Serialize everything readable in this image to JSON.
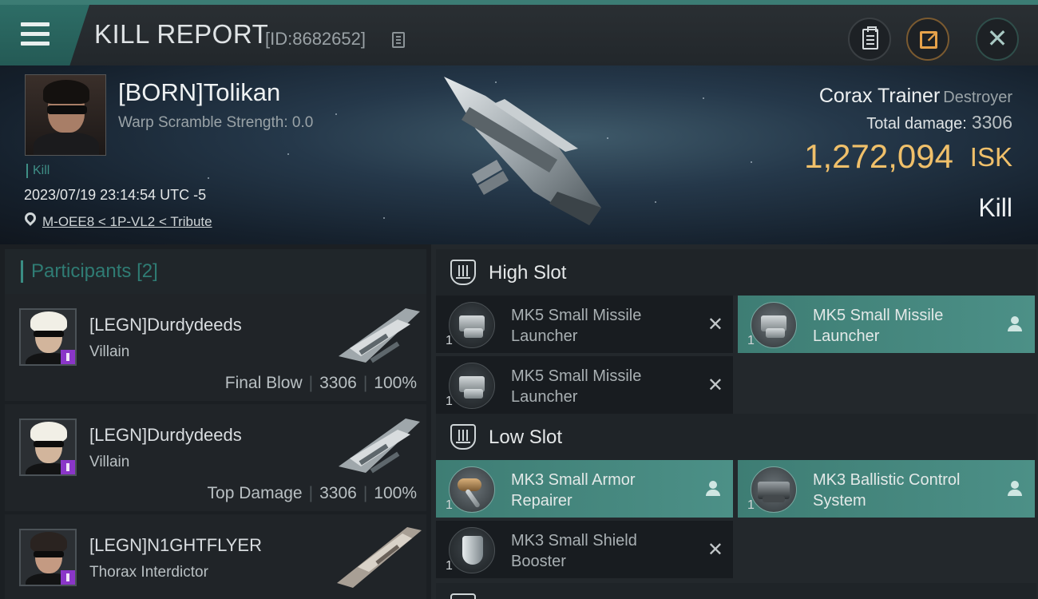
{
  "header": {
    "title": "KILL REPORT",
    "report_id": "[ID:8682652]"
  },
  "victim": {
    "name": "[BORN]Tolikan",
    "warp_scramble": "Warp Scramble Strength: 0.0",
    "tag": "Kill",
    "timestamp": "2023/07/19 23:14:54 UTC -5",
    "location": "M-OEE8 < 1P-VL2 < Tribute",
    "ship_name": "Corax Trainer",
    "ship_class": "Destroyer",
    "total_damage_label": "Total damage:",
    "total_damage": "3306",
    "isk_value": "1,272,094",
    "isk_unit": "ISK",
    "result": "Kill"
  },
  "participants": {
    "label": "Participants",
    "count": "[2]",
    "rows": [
      {
        "name": "[LEGN]Durdydeeds",
        "ship": "Villain",
        "role": "Final Blow",
        "damage": "3306",
        "percent": "100%"
      },
      {
        "name": "[LEGN]Durdydeeds",
        "ship": "Villain",
        "role": "Top Damage",
        "damage": "3306",
        "percent": "100%"
      },
      {
        "name": "[LEGN]N1GHTFLYER",
        "ship": "Thorax Interdictor"
      }
    ]
  },
  "fitting": {
    "high_slot": {
      "label": "High Slot",
      "modules": [
        {
          "name": "MK5 Small Missile Launcher",
          "qty": "1",
          "status": "destroyed"
        },
        {
          "name": "MK5 Small Missile Launcher",
          "qty": "1",
          "status": "dropped"
        },
        {
          "name": "MK5 Small Missile Launcher",
          "qty": "1",
          "status": "destroyed"
        }
      ]
    },
    "low_slot": {
      "label": "Low Slot",
      "modules": [
        {
          "name": "MK3 Small Armor Repairer",
          "qty": "1",
          "status": "dropped"
        },
        {
          "name": "MK3 Ballistic Control System",
          "qty": "1",
          "status": "dropped"
        },
        {
          "name": "MK3 Small Shield Booster",
          "qty": "1",
          "status": "destroyed"
        }
      ]
    }
  },
  "icons": {
    "menu": "menu-icon",
    "copy": "copy-icon",
    "clipboard": "clipboard-icon",
    "share": "share-icon",
    "close": "close-icon",
    "location": "location-pin-icon",
    "slot": "slot-icon",
    "destroyed": "x-icon",
    "dropped": "person-icon"
  },
  "colors": {
    "accent": "#3f8f86",
    "isk": "#f0c06a",
    "fitted": "#4c9087",
    "corp_badge": "#8a36c8"
  }
}
